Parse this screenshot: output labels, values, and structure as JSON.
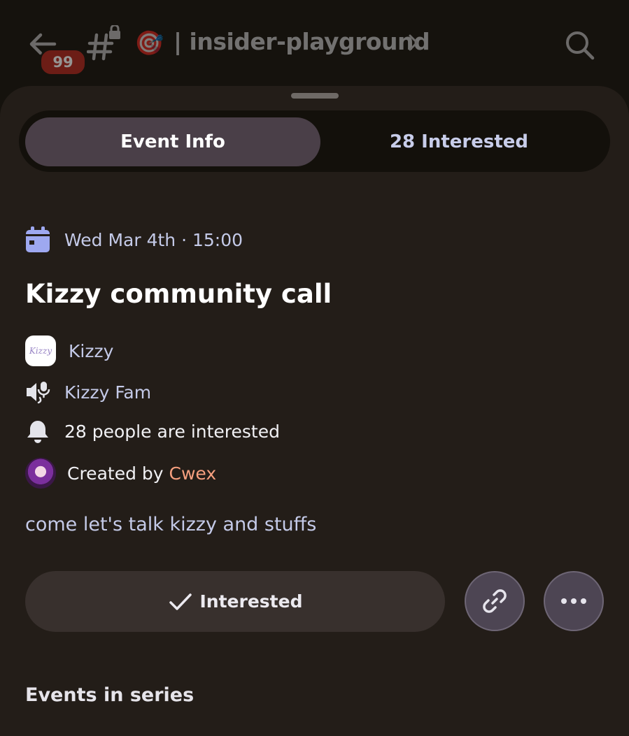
{
  "header": {
    "unread_badge": "99",
    "channel_emoji": "🎯",
    "channel_name": "| insider-playground"
  },
  "tabs": [
    {
      "label": "Event Info",
      "selected": true
    },
    {
      "label": "28 Interested",
      "selected": false
    }
  ],
  "event": {
    "datetime": "Wed Mar 4th · 15:00",
    "title": "Kizzy community call",
    "server_logo_text": "Kizzy",
    "server_name": "Kizzy",
    "stage_channel": "Kizzy Fam",
    "interested_text": "28 people are interested",
    "created_by_label": "Created by ",
    "creator": "Cwex",
    "description": "come let's talk kizzy and stuffs"
  },
  "actions": {
    "interested_label": "Interested"
  },
  "series_heading": "Events in series",
  "colors": {
    "background": "#15120d",
    "sheet": "#231d18",
    "selected_tab": "#4a3f48",
    "accent_text": "#c4cae8",
    "creator": "#f7a07f",
    "badge": "#b3261e",
    "calendar": "#9ea8f0"
  }
}
